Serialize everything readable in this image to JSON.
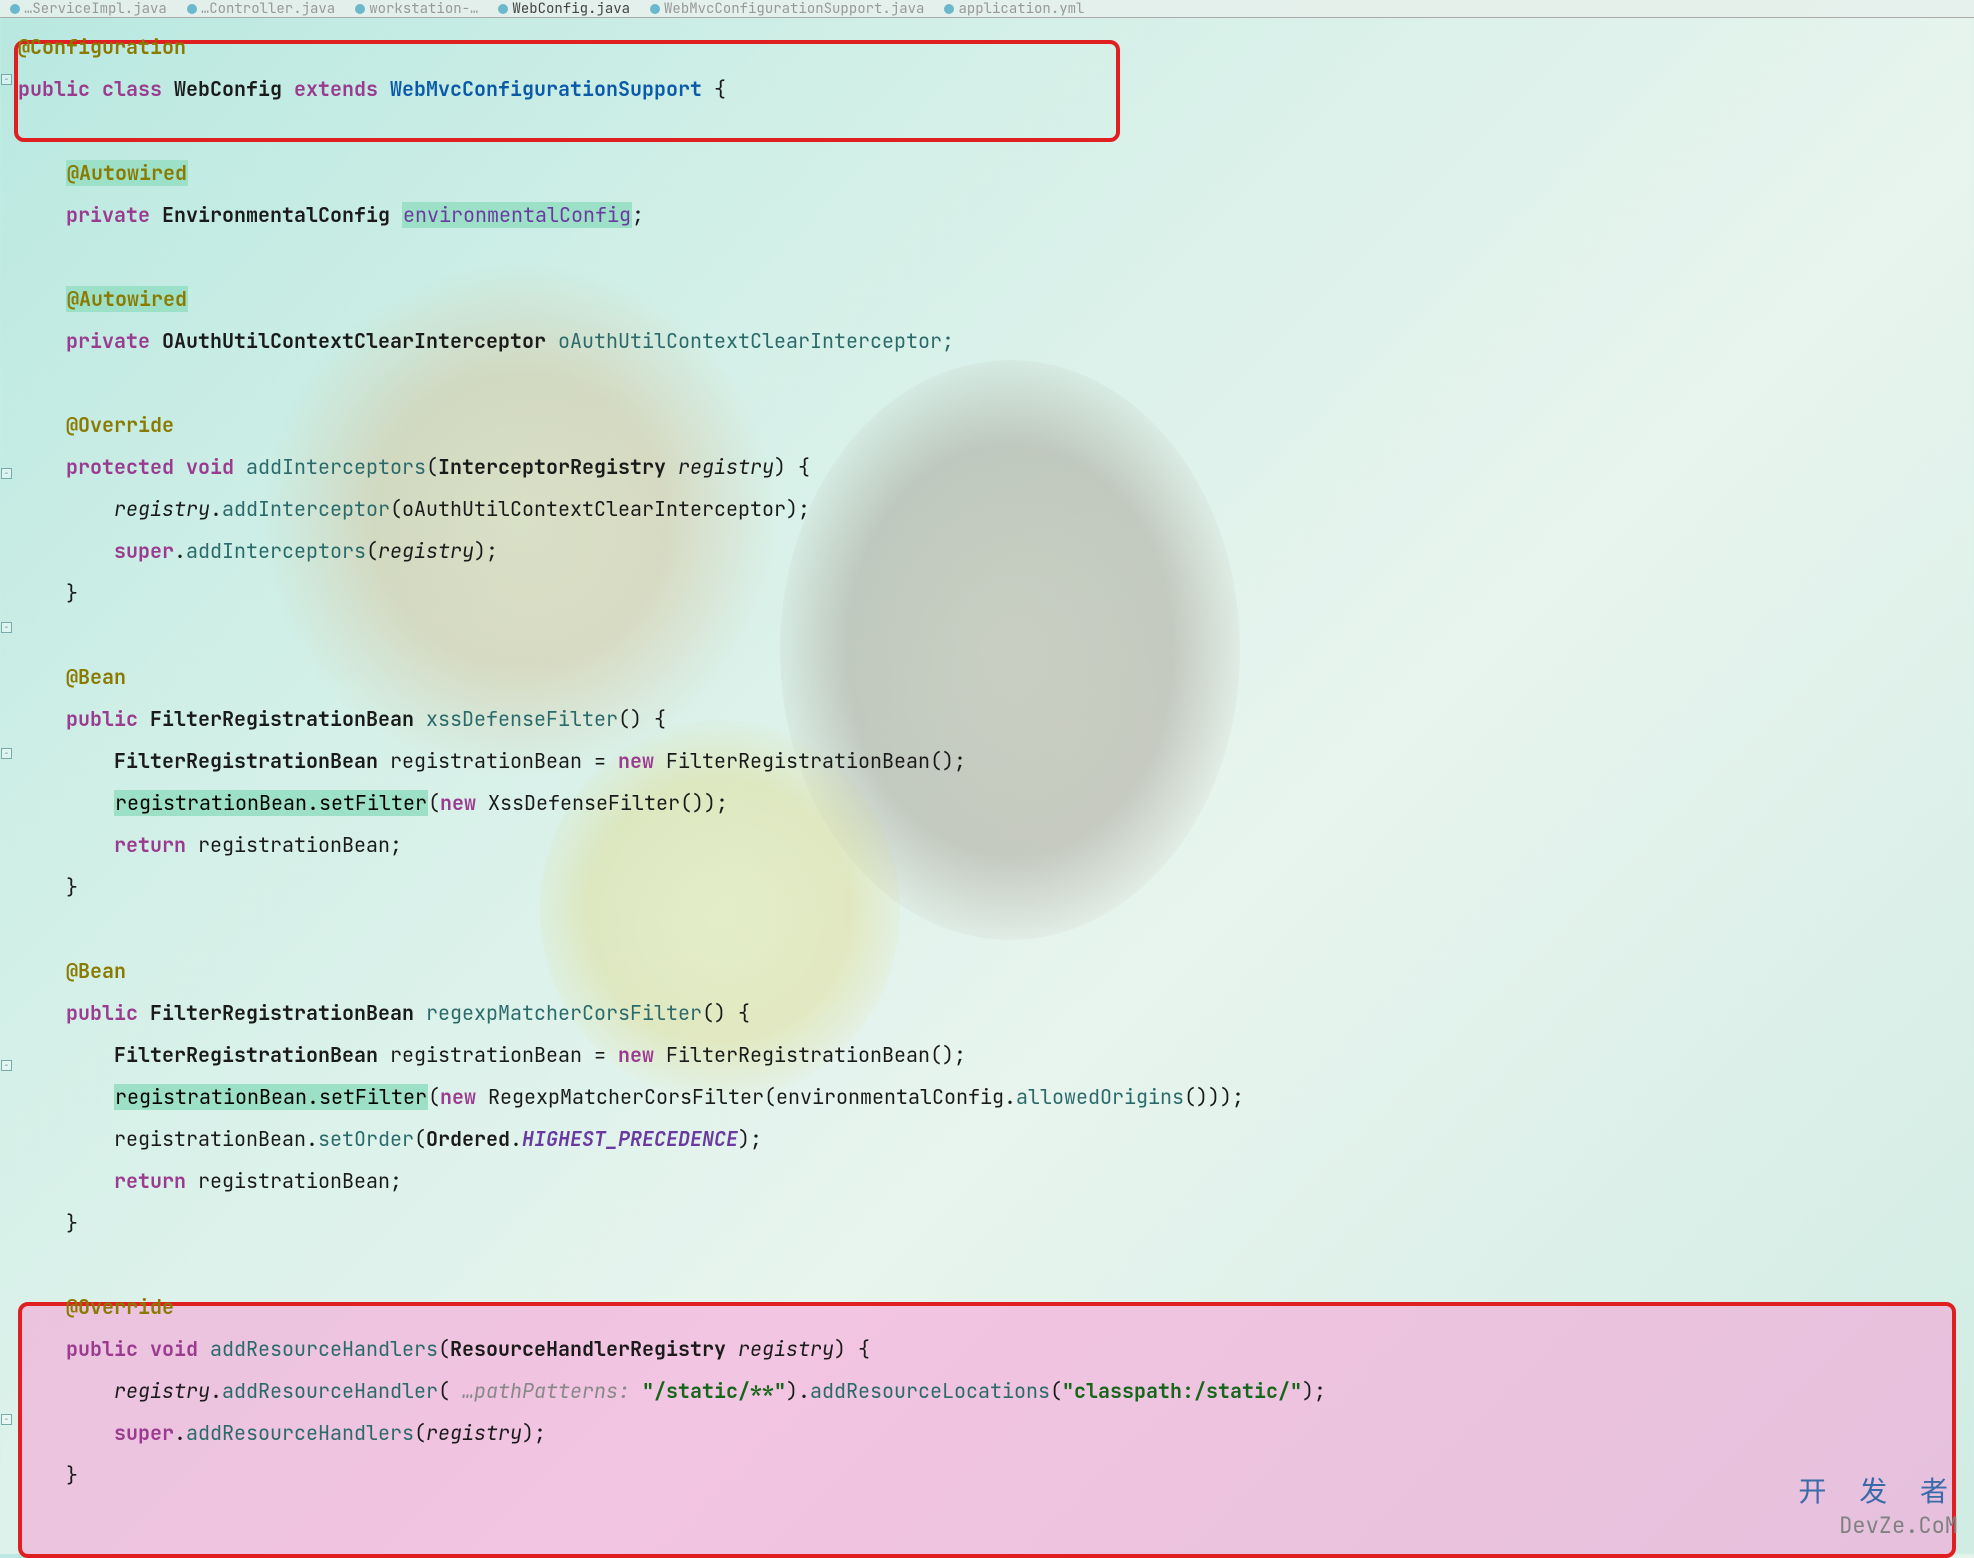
{
  "tabs": [
    {
      "label": "…ServiceImpl.java",
      "active": false
    },
    {
      "label": "…Controller.java",
      "active": false
    },
    {
      "label": "workstation-…",
      "active": false
    },
    {
      "label": "WebConfig.java",
      "active": true
    },
    {
      "label": "WebMvcConfigurationSupport.java",
      "active": false
    },
    {
      "label": "application.yml",
      "active": false
    }
  ],
  "watermark": {
    "cn": "开 发 者",
    "en": "DevZe.CoM"
  },
  "code": {
    "l1_ann": "@Configuration",
    "l2_kw": "public class ",
    "l2_name": "WebConfig ",
    "l2_ext": "extends ",
    "l2_sup": "WebMvcConfigurationSupport ",
    "l2_brace": "{",
    "l4_ann": "@Autowired",
    "l5_kw": "private ",
    "l5_type": "EnvironmentalConfig ",
    "l5_field": "environmentalConfig",
    "l5_semi": ";",
    "l7_ann": "@Autowired",
    "l8_kw": "private ",
    "l8_type": "OAuthUtilContextClearInterceptor ",
    "l8_field": "oAuthUtilContextClearInterceptor;",
    "l10_ann": "@Override",
    "l11_kw": "protected void ",
    "l11_meth": "addInterceptors",
    "l11_open": "(",
    "l11_ptype": "InterceptorRegistry ",
    "l11_pname": "registry",
    "l11_close": ") {",
    "l12_reg": "registry",
    "l12_dot": ".",
    "l12_call": "addInterceptor",
    "l12_arg": "(oAuthUtilContextClearInterceptor);",
    "l13_super": "super",
    "l13_dot": ".",
    "l13_call": "addInterceptors",
    "l13_open": "(",
    "l13_arg": "registry",
    "l13_close": ");",
    "l14_brace": "}",
    "l16_ann": "@Bean",
    "l17_kw": "public ",
    "l17_type": "FilterRegistrationBean ",
    "l17_meth": "xssDefenseFilter",
    "l17_sig": "() {",
    "l18_type": "FilterRegistrationBean ",
    "l18_var": "registrationBean = ",
    "l18_new": "new ",
    "l18_ctor": "FilterRegistrationBean();",
    "l19_hl": "registrationBean.setFilter",
    "l19_open": "(",
    "l19_new": "new ",
    "l19_ctor": "XssDefenseFilter());",
    "l20_ret": "return ",
    "l20_var": "registrationBean;",
    "l21_brace": "}",
    "l23_ann": "@Bean",
    "l24_kw": "public ",
    "l24_type": "FilterRegistrationBean ",
    "l24_meth": "regexpMatcherCorsFilter",
    "l24_sig": "() {",
    "l25_type": "FilterRegistrationBean ",
    "l25_var": "registrationBean = ",
    "l25_new": "new ",
    "l25_ctor": "FilterRegistrationBean();",
    "l26_hl": "registrationBean.setFilter",
    "l26_open": "(",
    "l26_new": "new ",
    "l26_ctor": "RegexpMatcherCorsFilter(environmentalConfig.",
    "l26_call": "allowedOrigins",
    "l26_close": "()));",
    "l27_var": "registrationBean.",
    "l27_call": "setOrder",
    "l27_open": "(",
    "l27_cls": "Ordered",
    "l27_dot": ".",
    "l27_const": "HIGHEST_PRECEDENCE",
    "l27_close": ");",
    "l28_ret": "return ",
    "l28_var": "registrationBean;",
    "l29_brace": "}",
    "l31_ann": "@Override",
    "l32_kw": "public void ",
    "l32_meth": "addResourceHandlers",
    "l32_open": "(",
    "l32_ptype": "ResourceHandlerRegistry ",
    "l32_pname": "registry",
    "l32_close": ") {",
    "l33_reg": "registry",
    "l33_dot": ".",
    "l33_c1": "addResourceHandler",
    "l33_h1": "( ",
    "l33_hint": "…pathPatterns: ",
    "l33_s1": "\"/static/**\"",
    "l33_mid": ").",
    "l33_c2": "addResourceLocations",
    "l33_h2": "(",
    "l33_s2": "\"classpath:/static/\"",
    "l33_end": ");",
    "l34_super": "super",
    "l34_dot": ".",
    "l34_call": "addResourceHandlers",
    "l34_open": "(",
    "l34_arg": "registry",
    "l34_close": ");",
    "l35_brace": "}"
  }
}
